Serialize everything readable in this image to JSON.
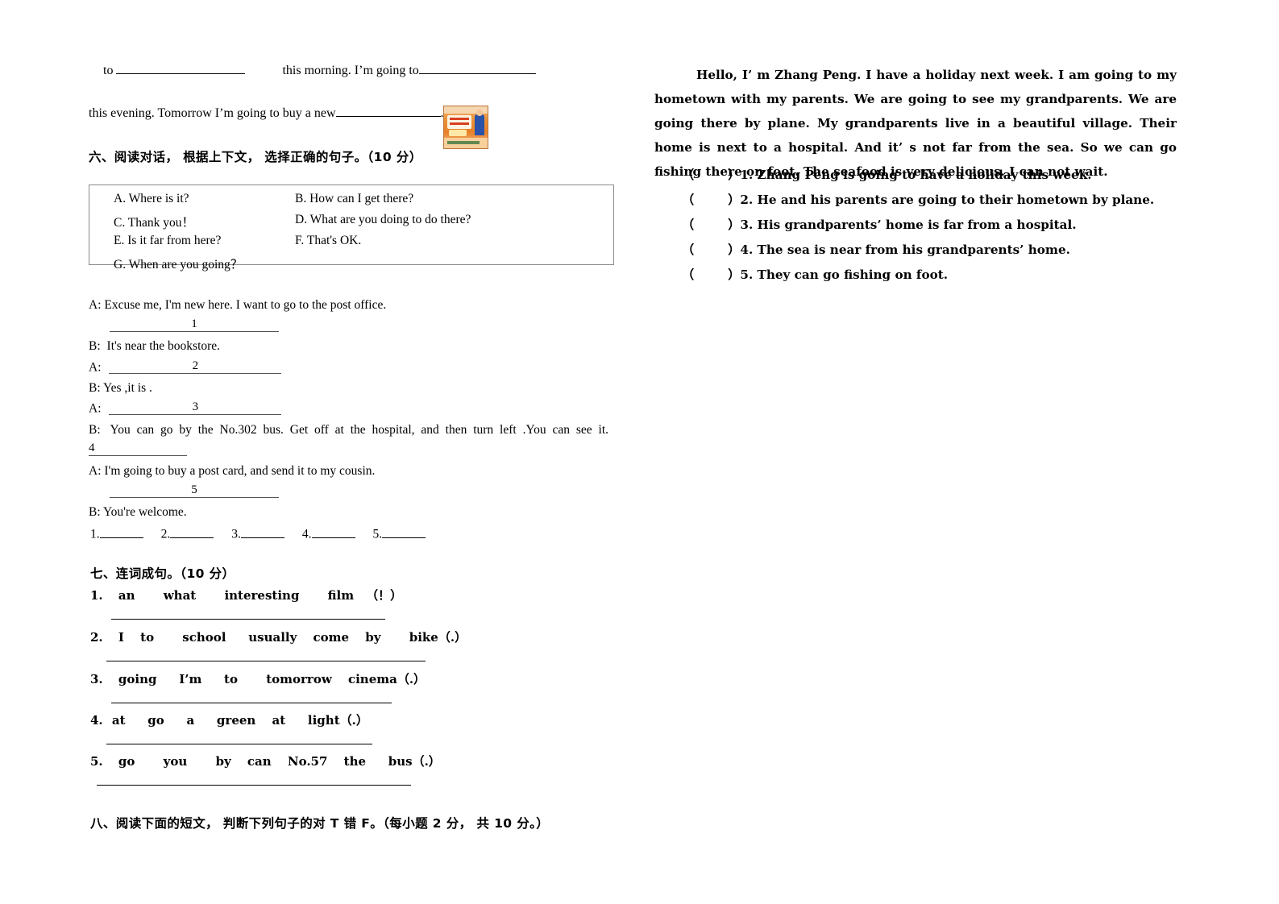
{
  "top_fragment": {
    "line1_prefix": "to",
    "line1_mid": "this morning. I’m going to",
    "line2_prefix": "this evening. Tomorrow I’m going to buy a new",
    "line2_suffix": ".",
    "book_thumbnail_alt": "english-workbook-cover"
  },
  "section_six": {
    "heading": "六、阅读对话， 根据上下文， 选择正确的句子。（10 分）",
    "options": [
      {
        "a": "A. Where is it?",
        "b": "B. How can I get there?"
      },
      {
        "a": "C. Thank you！",
        "b": "D. What are you doing to do there?"
      },
      {
        "a": "E. Is it far from here?",
        "b": "F. That's OK."
      },
      {
        "a": "G. When are you going？",
        "b": ""
      }
    ],
    "dialogue": [
      {
        "speaker": "A:",
        "text": "Excuse me, I'm new here. I want to go to the post office."
      },
      {
        "blank": "1",
        "style": "indent"
      },
      {
        "speaker": "B:",
        "text": "It's near the bookstore."
      },
      {
        "speaker": "A:",
        "blank": "2",
        "style": "inline"
      },
      {
        "speaker": "B:",
        "text": "Yes ,it is ."
      },
      {
        "speaker": "A:",
        "blank": "3",
        "style": "inline"
      },
      {
        "speaker": "B:",
        "text": "You can go by the No.302 bus. Get off at the hospital, and then turn left .You can see it."
      },
      {
        "blank": "4",
        "style": "left-narrow"
      },
      {
        "speaker": "A:",
        "text": "I'm going to buy a post card, and send it to my cousin."
      },
      {
        "blank": "5",
        "style": "indent"
      },
      {
        "speaker": "B:",
        "text": "You're welcome."
      }
    ],
    "answer_numbers": [
      "1.",
      "2.",
      "3.",
      "4.",
      "5."
    ]
  },
  "section_seven": {
    "heading": "七、连词成句。（10 分）",
    "items": [
      {
        "num": "1.",
        "words": "an    what    interesting   film （！）"
      },
      {
        "num": "2.",
        "words": "I   to   school   usually  come  by   bike（.）"
      },
      {
        "num": "3.",
        "words": "going   I’m   to   tomorrow   cinema（.）"
      },
      {
        "num": "4.",
        "words": "at   go   a   green  at   light（.）"
      },
      {
        "num": "5.",
        "words": "go   you   by  can  No.57  the   bus（.）"
      }
    ]
  },
  "section_eight": {
    "heading": "八、阅读下面的短文， 判断下列句子的对 T 错 F。（每小题 2 分， 共 10 分。）"
  },
  "reading": {
    "passage": "Hello, I’ m Zhang Peng. I have a holiday next week. I am going to my hometown with my parents. We are going to see my grandparents. We are going there by plane. My grandparents live in a beautiful village. Their home is next to a hospital. And it’ s not far from the sea. So we can go fishing there on foot. The seafood is very delicious. I can not wait.",
    "questions": [
      {
        "mark": "（",
        "close": "）1.",
        "text": "Zhang Peng is going to have a holiday this week."
      },
      {
        "mark": "（",
        "close": "）2.",
        "text": "He and his parents are going to their hometown by plane."
      },
      {
        "mark": "（",
        "close": "）3.",
        "text": "His grandparents’  home is far from a hospital."
      },
      {
        "mark": "（",
        "close": "）4.",
        "text": "The sea is near from his grandparents’  home."
      },
      {
        "mark": "（",
        "close": "）5.",
        "text": "They can go fishing on foot."
      }
    ]
  },
  "colors": {
    "ink": "#000000",
    "rule": "#555555",
    "box_border": "#8a8a8a",
    "book_orange": "#e8812a"
  }
}
